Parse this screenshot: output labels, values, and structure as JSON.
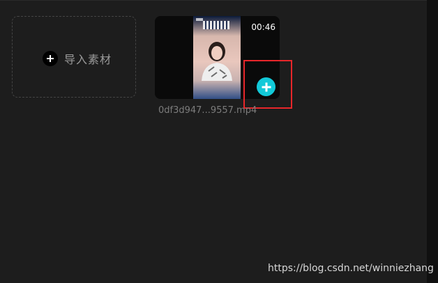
{
  "import": {
    "label": "导入素材",
    "icon": "plus-circle-icon"
  },
  "media": {
    "duration": "00:46",
    "filename": "0df3d947...9557.mp4",
    "add_icon": "plus-circle-icon",
    "accent_color": "#12c9d8"
  },
  "annotation": {
    "highlight_color": "#e8262a"
  },
  "watermark": {
    "text": "https://blog.csdn.net/winniezhang"
  }
}
